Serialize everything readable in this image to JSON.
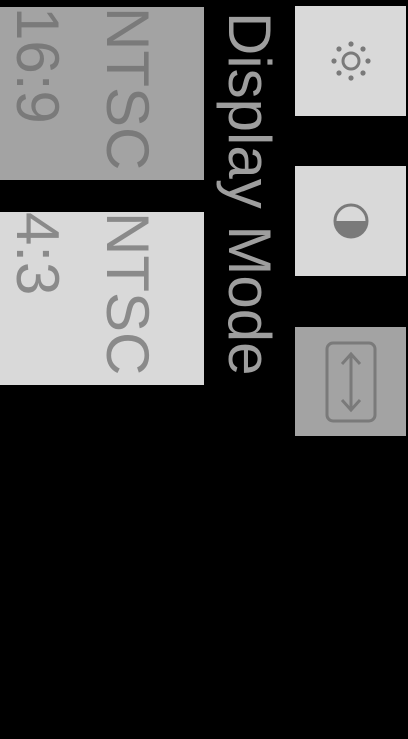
{
  "header": {
    "title": "Display Mode"
  },
  "toolbar": {
    "brightness_icon": "brightness-sun-icon",
    "contrast_icon": "contrast-half-circle-icon",
    "display_mode_icon": "resize-vertical-arrow-icon",
    "selected": "display-mode"
  },
  "modes": [
    {
      "line1": "NTSC",
      "line2": "16:9",
      "selected": true
    },
    {
      "line1": "NTSC",
      "line2": "4:3",
      "selected": false
    }
  ],
  "colors": {
    "background": "#000000",
    "button_light": "#d9d9d9",
    "button_selected": "#a3a3a3",
    "title_text": "#9e9e9e",
    "icon_dark": "#7a7a7a"
  }
}
